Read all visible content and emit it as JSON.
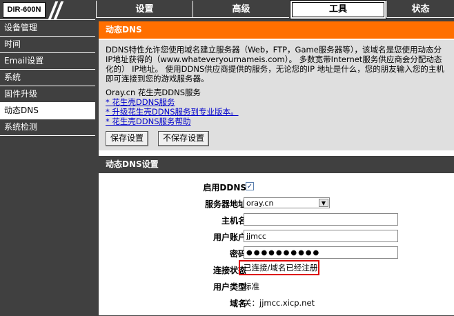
{
  "header": {
    "model": "DIR-600N",
    "tabs": [
      {
        "label": "设置"
      },
      {
        "label": "高级"
      },
      {
        "label": "工具"
      },
      {
        "label": "状态"
      }
    ]
  },
  "sidebar": {
    "items": [
      {
        "label": "设备管理"
      },
      {
        "label": "时间"
      },
      {
        "label": "Email设置"
      },
      {
        "label": "系统"
      },
      {
        "label": "固件升级"
      },
      {
        "label": "动态DNS"
      },
      {
        "label": "系统检测"
      }
    ]
  },
  "ddns_info": {
    "title": "动态DNS",
    "description": [
      "DDNS特性允许您使用域名建立服务器（Web，FTP，Game服务器等），该域名是您使用动态分",
      "IP地址获得的（www.whateveryournameis.com）。 多数宽带Internet服务供应商会分配动态",
      "化的） IP地址。 使用DDNS供应商提供的服务，无论您的IP 地址是什么，您的朋友输入您的主机",
      "即可连接到您的游戏服务器。"
    ],
    "provider_text": "Oray.cn 花生壳DDNS服务",
    "links": [
      "* 花生壳DDNS服务",
      "* 升级花生壳DDNS服务到专业版本。",
      "* 花生壳DDNS服务帮助"
    ],
    "save_label": "保存设置",
    "nosave_label": "不保存设置"
  },
  "ddns_settings": {
    "title": "动态DNS设置",
    "enable_label": "启用DDNS",
    "enable_checked": true,
    "server_label": "服务器地址",
    "server_value": "oray.cn",
    "host_label": "主机名",
    "host_value": "",
    "user_label": "用户账户",
    "user_value": "jjmcc",
    "password_label": "密码",
    "password_value": "●●●●●●●●●●",
    "status_label": "连接状态",
    "status_value": "已连接/域名已经注册",
    "usertype_label": "用户类型",
    "usertype_value": "标准",
    "domain_label": "域名",
    "domain_value": "关：jjmcc.xicp.net"
  },
  "colors": {
    "accent": "#ff6f00",
    "dark": "#404040",
    "highlight": "#dd0000"
  }
}
